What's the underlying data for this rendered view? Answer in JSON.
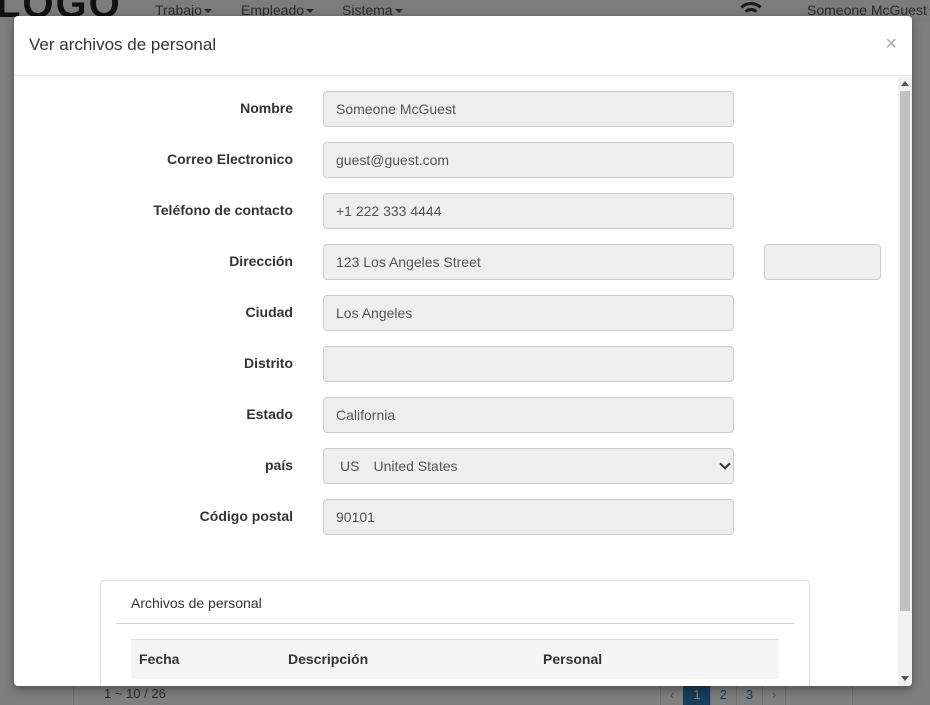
{
  "background": {
    "logo": "LOGO",
    "menus": [
      "Trabajo",
      "Empleado",
      "Sistema"
    ],
    "user": "Someone McGuest",
    "record_count": "1 ~ 10 / 26",
    "pager": {
      "prev": "‹",
      "pages": [
        "1",
        "2",
        "3"
      ],
      "next": "›"
    }
  },
  "modal": {
    "title": "Ver archivos de personal",
    "close": "×",
    "fields": [
      {
        "label": "Nombre",
        "value": "Someone McGuest"
      },
      {
        "label": "Correo Electronico",
        "value": "guest@guest.com"
      },
      {
        "label": "Teléfono de contacto",
        "value": "+1 222 333 4444"
      },
      {
        "label": "Dirección",
        "value": "123 Los Angeles Street",
        "extra": ""
      },
      {
        "label": "Ciudad",
        "value": "Los Angeles"
      },
      {
        "label": "Distrito",
        "value": ""
      },
      {
        "label": "Estado",
        "value": "California"
      },
      {
        "label": "país",
        "code": "US",
        "value": "United States"
      },
      {
        "label": "Código postal",
        "value": "90101"
      }
    ],
    "panel": {
      "title": "Archivos de personal",
      "columns": [
        "Fecha",
        "Descripción",
        "Personal"
      ]
    }
  }
}
